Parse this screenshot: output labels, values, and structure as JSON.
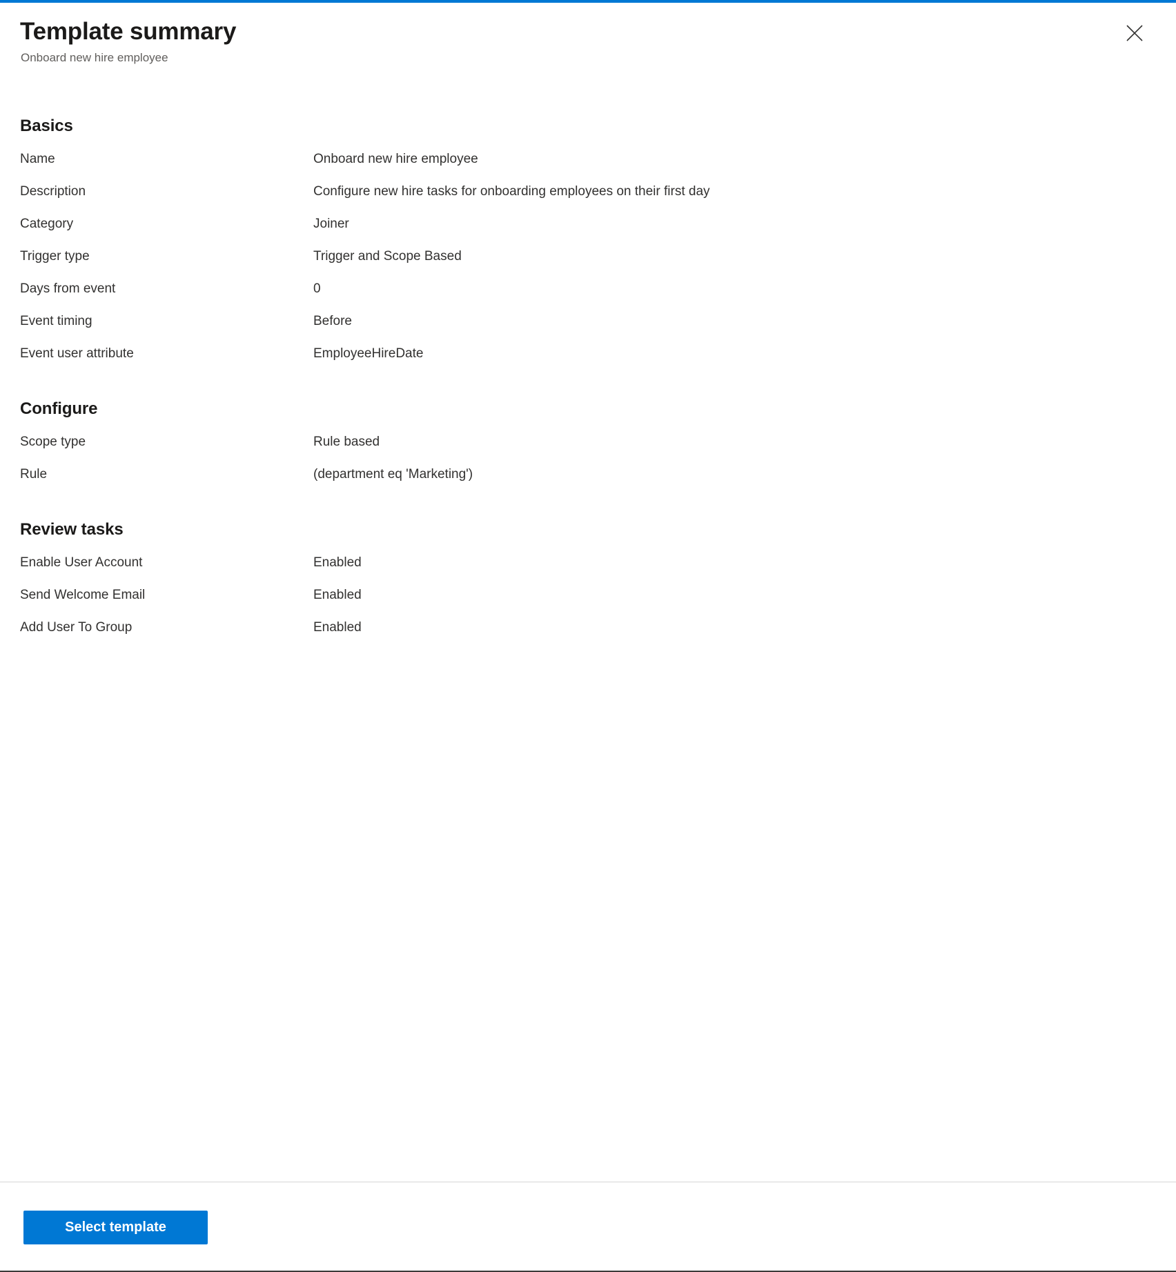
{
  "header": {
    "title": "Template summary",
    "subtitle": "Onboard new hire employee",
    "close_icon": "close-icon",
    "close_label": "Close"
  },
  "theme": {
    "accent": "#0078d4",
    "title_color": "#1b1a19",
    "text_color": "#323130",
    "subtle_text_color": "#605e5c",
    "divider_color": "#d6d6d6"
  },
  "sections": [
    {
      "heading": "Basics",
      "rows": [
        {
          "label": "Name",
          "value": "Onboard new hire employee"
        },
        {
          "label": "Description",
          "value": "Configure new hire tasks for onboarding employees on their first day"
        },
        {
          "label": "Category",
          "value": "Joiner"
        },
        {
          "label": "Trigger type",
          "value": "Trigger and Scope Based"
        },
        {
          "label": "Days from event",
          "value": "0"
        },
        {
          "label": "Event timing",
          "value": "Before"
        },
        {
          "label": "Event user attribute",
          "value": "EmployeeHireDate"
        }
      ]
    },
    {
      "heading": "Configure",
      "rows": [
        {
          "label": "Scope type",
          "value": "Rule based"
        },
        {
          "label": "Rule",
          "value": "(department eq 'Marketing')"
        }
      ]
    },
    {
      "heading": "Review tasks",
      "rows": [
        {
          "label": "Enable User Account",
          "value": "Enabled"
        },
        {
          "label": "Send Welcome Email",
          "value": "Enabled"
        },
        {
          "label": "Add User To Group",
          "value": "Enabled"
        }
      ]
    }
  ],
  "footer": {
    "primary_button_label": "Select template"
  }
}
